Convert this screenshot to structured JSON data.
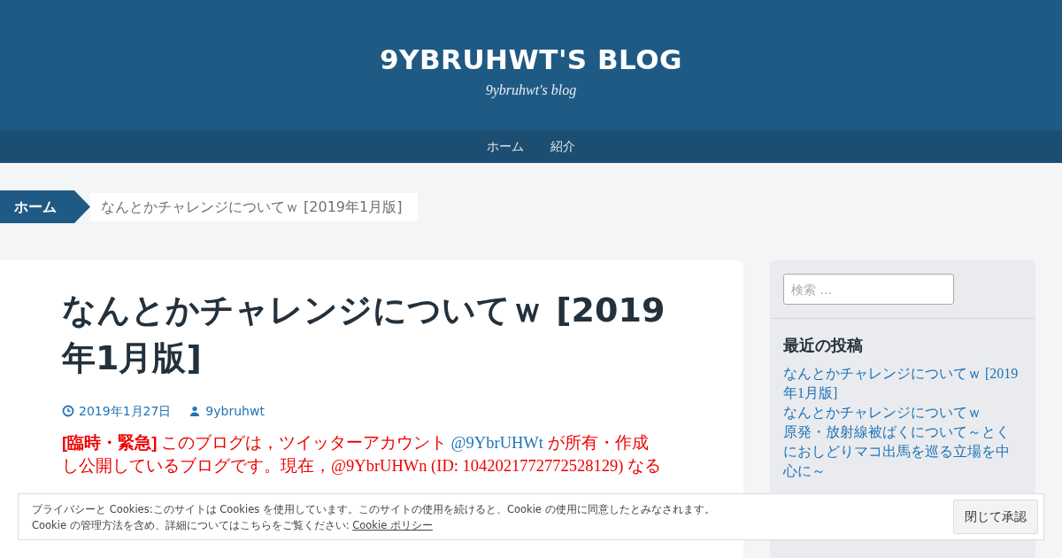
{
  "site": {
    "title": "9YBRUHWT'S BLOG",
    "tagline": "9ybruhwt's blog"
  },
  "nav": [
    {
      "label": "ホーム"
    },
    {
      "label": "紹介"
    }
  ],
  "breadcrumb": {
    "home": "ホーム",
    "current": "なんとかチャレンジについてｗ [2019年1月版]"
  },
  "post": {
    "title": "なんとかチャレンジについてｗ [2019年1月版]",
    "date": "2019年1月27日",
    "author": "9ybruhwt",
    "lines": [
      [
        {
          "kind": "bold",
          "text": "[臨時・緊急]"
        },
        {
          "kind": "plain",
          "text": " このブログは，ツイッターアカウント "
        },
        {
          "kind": "link",
          "text": "@9YbrUHWt"
        },
        {
          "kind": "plain",
          "text": " が所有・作成"
        }
      ],
      [
        {
          "kind": "plain",
          "text": "し公開しているブログです。現在，@9YbrUHWn (ID: 1042021772772528129) なる"
        }
      ]
    ]
  },
  "sidebar": {
    "search": {
      "placeholder": "検索 …"
    },
    "recent_title": "最近の投稿",
    "recent": [
      "なんとかチャレンジについてｗ [2019年1月版]",
      "なんとかチャレンジについてｗ",
      "原発・放射線被ばくについて～とくにおしどりマコ出馬を巡る立場を中心に～"
    ]
  },
  "cookie_banner": {
    "line1": "プライバシーと Cookies:このサイトは Cookies を使用しています。このサイトの使用を続けると、Cookie の使用に同意したとみなされます。",
    "line2": "Cookie の管理方法を含め、詳細についてはこちらをご覧ください:",
    "link": "Cookie ポリシー",
    "button": "閉じて承認"
  }
}
